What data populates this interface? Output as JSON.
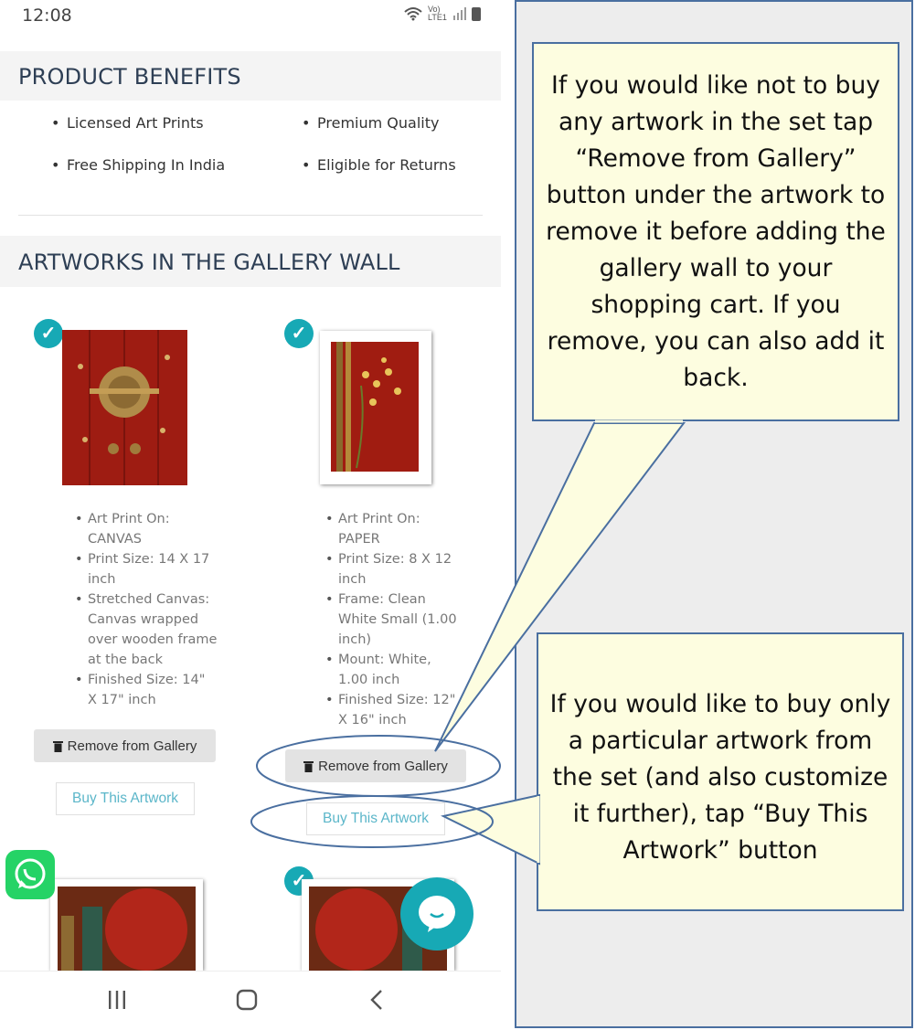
{
  "status_bar": {
    "time": "12:08",
    "network_label": "Vo) LTE1"
  },
  "sections": {
    "benefits_title": "PRODUCT BENEFITS",
    "gallery_title": "ARTWORKS IN THE GALLERY WALL"
  },
  "benefits": [
    "Licensed Art Prints",
    "Premium Quality",
    "Free Shipping In India",
    "Eligible for Returns"
  ],
  "artworks": [
    {
      "specs": [
        "Art Print On:",
        "CANVAS",
        "Print Size: 14 X 17",
        "inch",
        "Stretched Canvas:",
        "Canvas wrapped",
        "over wooden frame",
        "at the back",
        "Finished Size: 14\"",
        "X 17\" inch"
      ],
      "remove_label": "Remove from Gallery",
      "buy_label": "Buy This Artwork"
    },
    {
      "specs": [
        "Art Print On:",
        "PAPER",
        "Print Size: 8 X 12",
        "inch",
        "Frame: Clean",
        "White Small (1.00",
        "inch)",
        "Mount: White,",
        "1.00 inch",
        "Finished Size: 12\"",
        "X 16\" inch"
      ],
      "remove_label": "Remove from Gallery",
      "buy_label": "Buy This Artwork"
    }
  ],
  "callouts": {
    "remove": "If you would like not to buy any artwork in the set tap “Remove from Gallery” button under the artwork to remove it before adding the gallery wall to your shopping cart. If you remove, you can also add it back.",
    "buy": "If you would like to buy only a particular artwork from the set (and also customize it further), tap “Buy This Artwork” button"
  },
  "colors": {
    "accent": "#17a9b5",
    "callout_bg": "#fdfde0",
    "callout_border": "#4a6fa0",
    "panel_bg": "#ededed"
  },
  "icons": [
    "wifi-icon",
    "signal-icon",
    "battery-icon",
    "check-icon",
    "trash-icon",
    "whatsapp-icon",
    "chat-icon",
    "recents-icon",
    "home-icon",
    "back-icon"
  ]
}
